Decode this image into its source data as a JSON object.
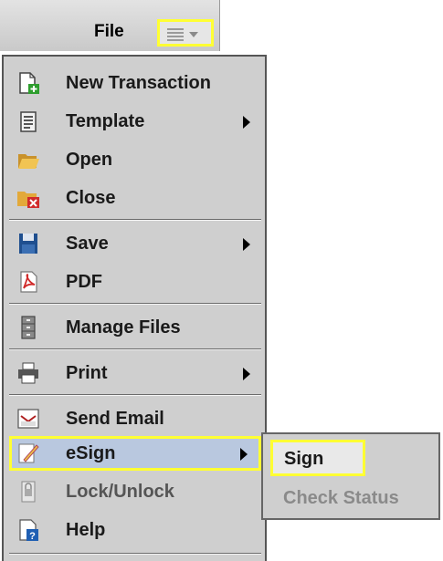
{
  "toolbar": {
    "file_label": "File",
    "menu_icon": "list-dropdown-icon"
  },
  "menu": {
    "items": [
      {
        "label": "New Transaction",
        "icon": "new-transaction-icon",
        "submenu": false
      },
      {
        "label": "Template",
        "icon": "template-icon",
        "submenu": true
      },
      {
        "label": "Open",
        "icon": "open-folder-icon",
        "submenu": false
      },
      {
        "label": "Close",
        "icon": "close-folder-icon",
        "submenu": false
      },
      {
        "label": "Save",
        "icon": "floppy-disk-icon",
        "submenu": true
      },
      {
        "label": "PDF",
        "icon": "pdf-icon",
        "submenu": false
      },
      {
        "label": "Manage Files",
        "icon": "file-cabinet-icon",
        "submenu": false
      },
      {
        "label": "Print",
        "icon": "printer-icon",
        "submenu": true
      },
      {
        "label": "Send Email",
        "icon": "email-icon",
        "submenu": false
      },
      {
        "label": "eSign",
        "icon": "pen-sign-icon",
        "submenu": true,
        "selected": true
      },
      {
        "label": "Lock/Unlock",
        "icon": "lock-icon",
        "submenu": false,
        "disabled": true
      },
      {
        "label": "Help",
        "icon": "help-icon",
        "submenu": false
      }
    ]
  },
  "esign_submenu": {
    "sign_label": "Sign",
    "check_status_label": "Check Status"
  },
  "colors": {
    "highlight_border": "#ffff33",
    "selected_bg": "#b9c8df",
    "menu_bg": "#cfcfcf"
  }
}
